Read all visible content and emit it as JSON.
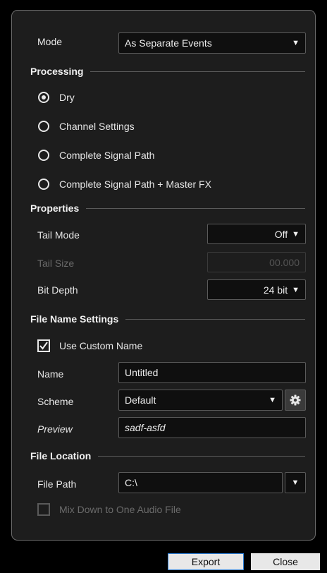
{
  "mode": {
    "label": "Mode",
    "value": "As Separate Events"
  },
  "processing": {
    "title": "Processing",
    "options": [
      {
        "label": "Dry",
        "selected": true
      },
      {
        "label": "Channel Settings",
        "selected": false
      },
      {
        "label": "Complete Signal Path",
        "selected": false
      },
      {
        "label": "Complete Signal Path + Master FX",
        "selected": false
      }
    ]
  },
  "properties": {
    "title": "Properties",
    "tail_mode": {
      "label": "Tail Mode",
      "value": "Off"
    },
    "tail_size": {
      "label": "Tail Size",
      "value": "00.000"
    },
    "bit_depth": {
      "label": "Bit Depth",
      "value": "24 bit"
    }
  },
  "file_name_settings": {
    "title": "File Name Settings",
    "use_custom_name": {
      "label": "Use Custom Name",
      "checked": true
    },
    "name": {
      "label": "Name",
      "value": "Untitled"
    },
    "scheme": {
      "label": "Scheme",
      "value": "Default"
    },
    "preview": {
      "label": "Preview",
      "value": "sadf-asfd"
    }
  },
  "file_location": {
    "title": "File Location",
    "file_path": {
      "label": "File Path",
      "value": "C:\\"
    },
    "mix_down": {
      "label": "Mix Down to One Audio File",
      "checked": false
    }
  },
  "buttons": {
    "export": "Export",
    "close": "Close"
  },
  "icons": {
    "dropdown": "chevron-down-icon",
    "settings": "gear-icon",
    "check": "checkmark-icon"
  },
  "colors": {
    "accent": "#2c7dd4",
    "panel": "#1d1d1d",
    "field": "#0f0f0f"
  }
}
